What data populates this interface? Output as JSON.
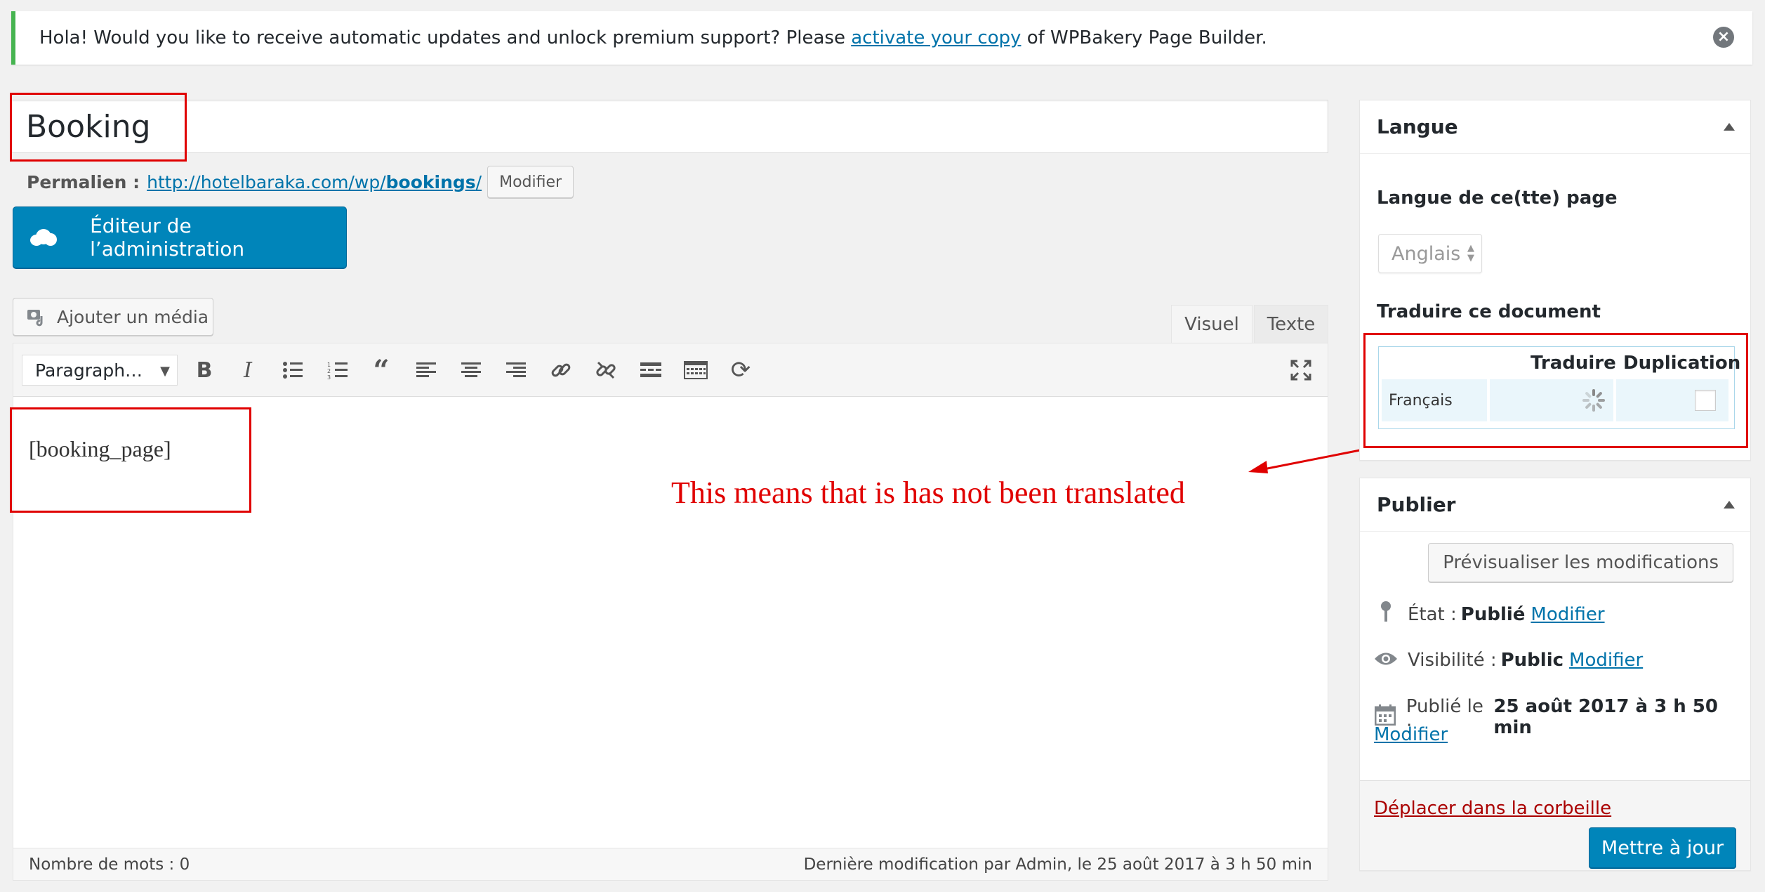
{
  "notice": {
    "text_before": "Hola! Would you like to receive automatic updates and unlock premium support? Please",
    "link": "activate your copy",
    "text_after": "of WPBakery Page Builder.",
    "close": "×"
  },
  "post": {
    "title": "Booking",
    "permalink_label": "Permalien :",
    "permalink_base": "http://hotelbaraka.com/wp/",
    "permalink_slug": "bookings",
    "permalink_trail": "/",
    "permalink_edit": "Modifier"
  },
  "builder": {
    "admin_editor_label": "Éditeur de l’administration"
  },
  "editor": {
    "add_media": "Ajouter un média",
    "tabs": [
      "Visuel",
      "Texte"
    ],
    "format": "Paragraph…",
    "toolbar_icons": [
      "bold-icon",
      "italic-icon",
      "bullet-list-icon",
      "numbered-list-icon",
      "blockquote-icon",
      "align-left-icon",
      "align-center-icon",
      "align-right-icon",
      "insert-link-icon",
      "remove-link-icon",
      "read-more-icon",
      "toolbar-toggle-icon",
      "vc-refresh-icon",
      "fullscreen-icon"
    ],
    "content": "[booking_page]",
    "word_count": "Nombre de mots : 0",
    "last_modified": "Dernière modification par Admin, le 25 août 2017 à 3 h 50 min"
  },
  "annotation": {
    "text": "This means that is has not been translated",
    "color": "#e00000"
  },
  "language_box": {
    "title": "Langue",
    "page_language_label": "Langue de ce(tte) page",
    "selected_language": "Anglais",
    "translate_label": "Traduire ce document",
    "col_translate": "Traduire",
    "col_duplicate": "Duplication",
    "row_language": "Français"
  },
  "publish_box": {
    "title": "Publier",
    "preview": "Prévisualiser les modifications",
    "status_label": "État :",
    "status_value": "Publié",
    "visibility_label": "Visibilité :",
    "visibility_value": "Public",
    "published_label": "Publié le :",
    "published_value": "25 août 2017 à 3 h 50 min",
    "edit": "Modifier",
    "trash": "Déplacer dans la corbeille",
    "update": "Mettre à jour"
  },
  "colors": {
    "primary": "#0085ba",
    "link": "#0073aa",
    "annotation_red": "#e00000",
    "notice_green": "#46b450"
  }
}
